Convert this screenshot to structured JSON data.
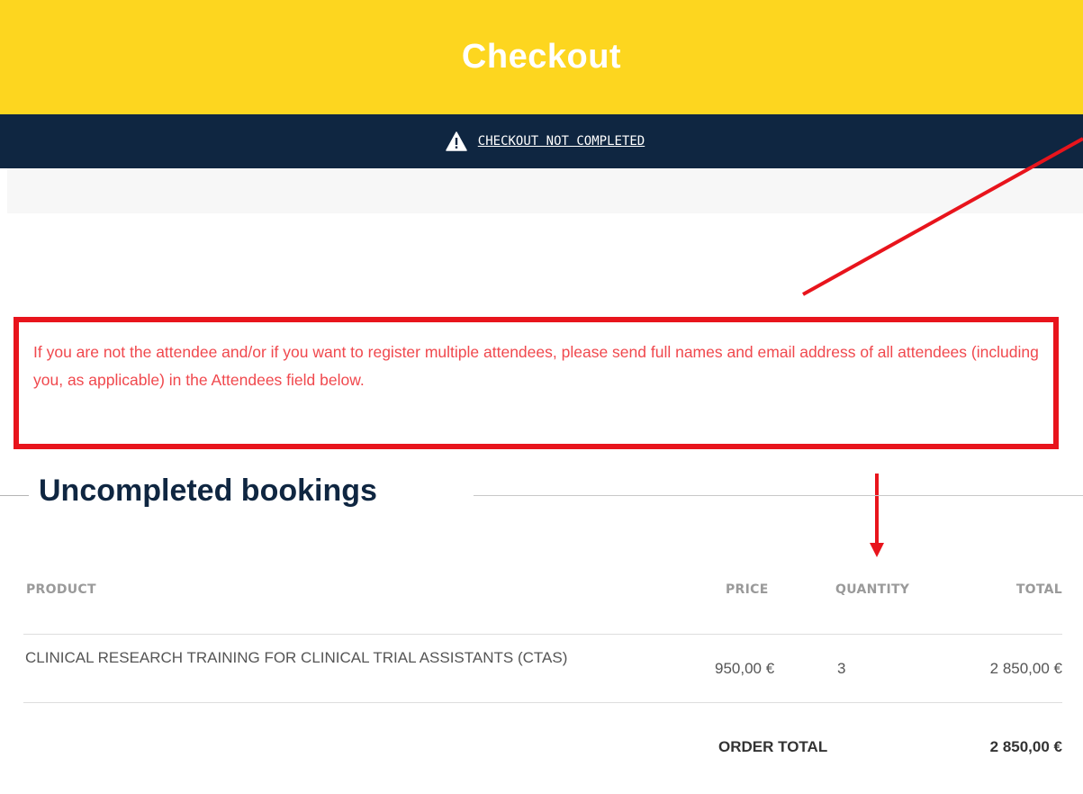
{
  "header": {
    "title": "Checkout"
  },
  "status_bar": {
    "icon": "warning-icon",
    "link_text": "CHECKOUT NOT COMPLETED"
  },
  "notice": {
    "text": "If you are not the attendee and/or if you want to register multiple attendees, please send full names and email address of all attendees (including you, as applicable) in the Attendees field below.",
    "color": "#f0484d",
    "border_color": "#e8141c"
  },
  "section": {
    "title": "Uncompleted bookings"
  },
  "table": {
    "headers": {
      "product": "PRODUCT",
      "price": "PRICE",
      "quantity": "QUANTITY",
      "total": "TOTAL"
    },
    "rows": [
      {
        "product": "CLINICAL RESEARCH TRAINING FOR CLINICAL TRIAL ASSISTANTS (CTAS)",
        "price": "950,00 €",
        "quantity": "3",
        "total": "2 850,00 €"
      }
    ],
    "order_total_label": "ORDER TOTAL",
    "order_total_value": "2 850,00 €"
  },
  "colors": {
    "header_bg": "#fdd61f",
    "status_bar_bg": "#0f2641",
    "annotation_red": "#e8141c",
    "heading_color": "#0f2641"
  }
}
